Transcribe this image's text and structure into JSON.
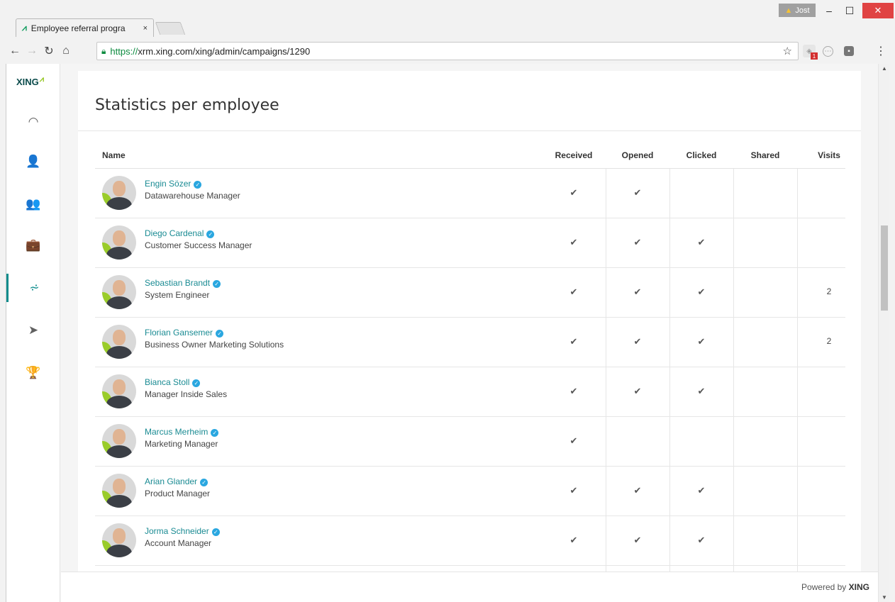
{
  "browser": {
    "tab_title": "Employee referral progra",
    "tab_close": "×",
    "profile_name": "Jost",
    "url_https": "https://",
    "url_rest": "xrm.xing.com/xing/admin/campaigns/1290",
    "ext_badge": "1",
    "window_controls": {
      "min": "–",
      "max": "☐",
      "close": "✕"
    }
  },
  "sidebar": {
    "logo": "XING",
    "logo_mark": "⩘",
    "items": [
      {
        "name": "dashboard-icon",
        "glyph": "◠"
      },
      {
        "name": "person-icon",
        "glyph": "👤"
      },
      {
        "name": "people-icon",
        "glyph": "👥"
      },
      {
        "name": "briefcase-icon",
        "glyph": "💼"
      },
      {
        "name": "statistics-icon",
        "glyph": "⩫"
      },
      {
        "name": "send-icon",
        "glyph": "➤"
      },
      {
        "name": "trophy-icon",
        "glyph": "🏆"
      }
    ]
  },
  "main": {
    "title": "Statistics per employee",
    "columns": {
      "name": "Name",
      "received": "Received",
      "opened": "Opened",
      "clicked": "Clicked",
      "shared": "Shared",
      "visits": "Visits"
    },
    "check_glyph": "✔",
    "verified_glyph": "✓",
    "rows": [
      {
        "name": "Engin Sözer",
        "role": "Datawarehouse Manager",
        "received": true,
        "opened": true,
        "clicked": false,
        "shared": false,
        "visits": ""
      },
      {
        "name": "Diego Cardenal",
        "role": "Customer Success Manager",
        "received": true,
        "opened": true,
        "clicked": true,
        "shared": false,
        "visits": ""
      },
      {
        "name": "Sebastian Brandt",
        "role": "System Engineer",
        "received": true,
        "opened": true,
        "clicked": true,
        "shared": false,
        "visits": "2"
      },
      {
        "name": "Florian Gansemer",
        "role": "Business Owner Marketing Solutions",
        "received": true,
        "opened": true,
        "clicked": true,
        "shared": false,
        "visits": "2"
      },
      {
        "name": "Bianca Stoll",
        "role": "Manager Inside Sales",
        "received": true,
        "opened": true,
        "clicked": true,
        "shared": false,
        "visits": ""
      },
      {
        "name": "Marcus Merheim",
        "role": "Marketing Manager",
        "received": true,
        "opened": false,
        "clicked": false,
        "shared": false,
        "visits": ""
      },
      {
        "name": "Arian Glander",
        "role": "Product Manager",
        "received": true,
        "opened": true,
        "clicked": true,
        "shared": false,
        "visits": ""
      },
      {
        "name": "Jorma Schneider",
        "role": "Account Manager",
        "received": true,
        "opened": true,
        "clicked": true,
        "shared": false,
        "visits": ""
      }
    ]
  },
  "footer": {
    "powered_prefix": "Powered by",
    "powered_brand": "XING"
  }
}
